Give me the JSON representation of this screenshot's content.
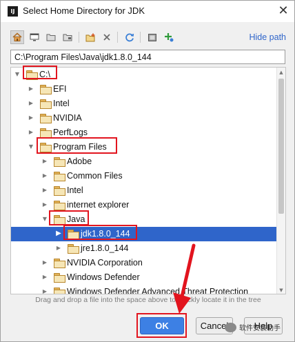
{
  "window": {
    "title": "Select Home Directory for JDK",
    "app_icon_text": "IJ",
    "close_glyph": "✕"
  },
  "toolbar": {
    "icons": [
      "home-icon",
      "desktop-icon",
      "project-folder-icon",
      "module-folder-icon",
      "new-folder-icon",
      "delete-icon",
      "refresh-icon",
      "show-hidden-icon",
      "add-icon"
    ],
    "hide_path_label": "Hide path"
  },
  "path": {
    "value": "C:\\Program Files\\Java\\jdk1.8.0_144"
  },
  "tree": {
    "rows": [
      {
        "label": "C:\\",
        "expanded": true
      },
      {
        "label": "EFI",
        "expanded": false
      },
      {
        "label": "Intel",
        "expanded": false
      },
      {
        "label": "NVIDIA",
        "expanded": false
      },
      {
        "label": "PerfLogs",
        "expanded": false
      },
      {
        "label": "Program Files",
        "expanded": true
      },
      {
        "label": "Adobe",
        "expanded": false
      },
      {
        "label": "Common Files",
        "expanded": false
      },
      {
        "label": "Intel",
        "expanded": false
      },
      {
        "label": "internet explorer",
        "expanded": false
      },
      {
        "label": "Java",
        "expanded": true
      },
      {
        "label": "jdk1.8.0_144",
        "expanded": false,
        "selected": true
      },
      {
        "label": "jre1.8.0_144",
        "expanded": false
      },
      {
        "label": "NVIDIA Corporation",
        "expanded": false
      },
      {
        "label": "Windows Defender",
        "expanded": false
      },
      {
        "label": "Windows Defender Advanced Threat Protection",
        "expanded": false
      }
    ]
  },
  "hint": "Drag and drop a file into the space above to quickly locate it in the tree",
  "buttons": {
    "ok": "OK",
    "cancel": "Cancel",
    "help": "Help"
  },
  "watermark": "软件安装助手",
  "colors": {
    "selection": "#2f65ca",
    "ok_button": "#3d80e4",
    "annotation": "#e2141e",
    "link": "#2f65ca"
  }
}
